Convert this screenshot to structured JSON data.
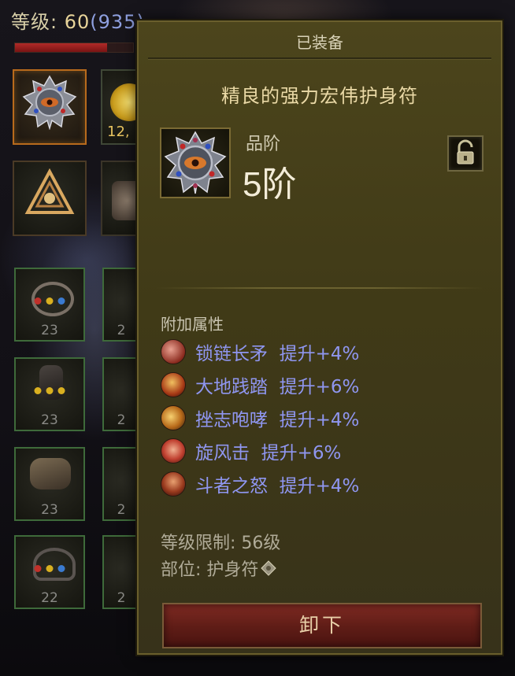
{
  "character": {
    "level_label": "等级: ",
    "level": "60",
    "paragon": "(935)",
    "xp_fill": 0.78
  },
  "inventory": {
    "gold_amount": "12,",
    "slots": [
      {
        "name": "amulet",
        "level": ""
      },
      {
        "name": "gold",
        "level": ""
      },
      {
        "name": "sigil",
        "level": ""
      },
      {
        "name": "relic",
        "level": ""
      },
      {
        "name": "gem-slot-1",
        "level": "23"
      },
      {
        "name": "gem-slot-2",
        "level": "23"
      },
      {
        "name": "gem-slot-3",
        "level": "23"
      },
      {
        "name": "gem-slot-4",
        "level": "22"
      },
      {
        "name": "gem-slot-5",
        "level": "2"
      },
      {
        "name": "gem-slot-6",
        "level": "2"
      },
      {
        "name": "gem-slot-7",
        "level": "2"
      },
      {
        "name": "gem-slot-8",
        "level": "2"
      }
    ]
  },
  "tooltip": {
    "header": "已装备",
    "item_name": "精良的强力宏伟护身符",
    "rank_label": "品阶",
    "rank_value": "5阶",
    "item_icon": "amulet-eye-icon",
    "lock_icon": "padlock-open-icon",
    "attributes_title": "附加属性",
    "attributes": [
      {
        "icon": "chain-spear-skill-icon",
        "text": "锁链长矛  提升+4%"
      },
      {
        "icon": "earth-stomp-skill-icon",
        "text": "大地践踏  提升+6%"
      },
      {
        "icon": "demoralize-shout-skill-icon",
        "text": "挫志咆哮  提升+4%"
      },
      {
        "icon": "whirlwind-skill-icon",
        "text": "旋风击  提升+6%"
      },
      {
        "icon": "wrath-of-berserker-skill-icon",
        "text": "斗者之怒  提升+4%"
      }
    ],
    "level_requirement": "等级限制: 56级",
    "slot_type": "部位: 护身符",
    "slot_type_icon": "amulet-slot-icon",
    "unequip_label": "卸下"
  },
  "colors": {
    "panel_bg": "#403a17",
    "attribute_text": "#8f96f0",
    "unequip_button": "#6e241c",
    "equipped_border": "#b86a1c"
  }
}
